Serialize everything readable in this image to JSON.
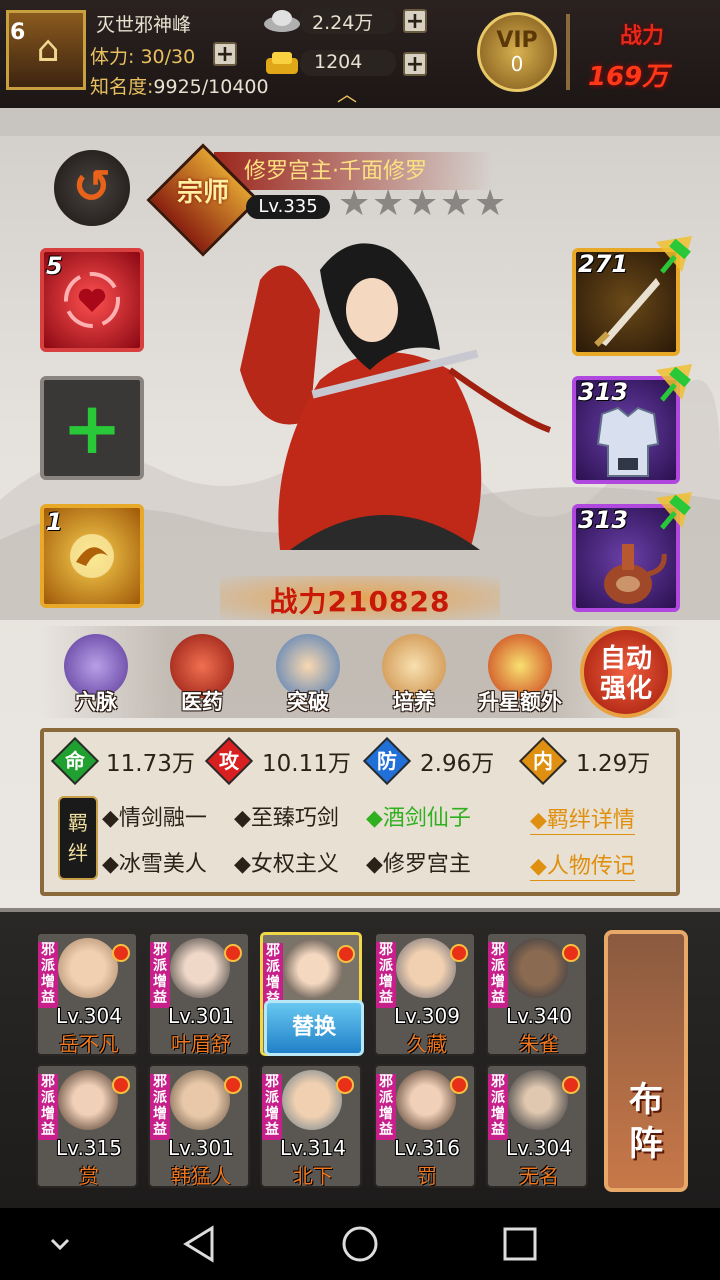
{
  "player": {
    "level": "6",
    "name": "灭世邪神峰",
    "stamina": "体力: 30/30",
    "fame_label": "知名度:",
    "fame_value": "9925/10400"
  },
  "currency": {
    "silver": "2.24万",
    "gold": "1204"
  },
  "vip": {
    "label": "VIP",
    "level": "0"
  },
  "top_power": {
    "label": "战力",
    "value": "169万"
  },
  "hero": {
    "rank_badge": "宗师",
    "name": "修罗宫主·千面修罗",
    "level": "Lv.335",
    "stars": 5,
    "power": "战力210828"
  },
  "skills": [
    {
      "count": "5",
      "icon": "heart-swirl-icon"
    },
    {
      "count": "",
      "icon": "add-icon"
    },
    {
      "count": "1",
      "icon": "golden-burst-icon"
    }
  ],
  "equipment": [
    {
      "level": "271",
      "icon": "sword-icon"
    },
    {
      "level": "313",
      "icon": "armor-icon"
    },
    {
      "level": "313",
      "icon": "vase-icon"
    }
  ],
  "menu": [
    {
      "label": "穴脉",
      "icon": "meridian-icon"
    },
    {
      "label": "医药",
      "icon": "medicine-icon"
    },
    {
      "label": "突破",
      "icon": "breakthrough-icon"
    },
    {
      "label": "培养",
      "icon": "cultivate-icon"
    },
    {
      "label": "升星额外",
      "icon": "star-up-icon"
    }
  ],
  "auto_button": {
    "line1": "自动",
    "line2": "强化"
  },
  "stats": [
    {
      "badge": "命",
      "value": "11.73万",
      "color": "#20a030"
    },
    {
      "badge": "攻",
      "value": "10.11万",
      "color": "#d82020"
    },
    {
      "badge": "防",
      "value": "2.96万",
      "color": "#2070d8"
    },
    {
      "badge": "内",
      "value": "1.29万",
      "color": "#e09010"
    }
  ],
  "bonds": {
    "tag": "羁绊",
    "row1": [
      "◆情剑融一",
      "◆至臻巧剑",
      "◆酒剑仙子"
    ],
    "row2": [
      "◆冰雪美人",
      "◆女权主义",
      "◆修罗宫主"
    ],
    "link1": "◆羁绊详情",
    "link2": "◆人物传记"
  },
  "lineup": {
    "tag": "邪派增益",
    "replace_label": "替换",
    "formation_label": "布阵",
    "row1": [
      {
        "lv": "Lv.304",
        "name": "岳不凡"
      },
      {
        "lv": "Lv.301",
        "name": "叶眉舒"
      },
      {
        "lv": "",
        "name": ""
      },
      {
        "lv": "Lv.309",
        "name": "久藏"
      },
      {
        "lv": "Lv.340",
        "name": "朱雀"
      }
    ],
    "row2": [
      {
        "lv": "Lv.315",
        "name": "赏"
      },
      {
        "lv": "Lv.301",
        "name": "韩猛人"
      },
      {
        "lv": "Lv.314",
        "name": "北下"
      },
      {
        "lv": "Lv.316",
        "name": "罚"
      },
      {
        "lv": "Lv.304",
        "name": "无名"
      }
    ]
  },
  "colors": {
    "accent_red": "#c81808",
    "gold": "#e8a828",
    "purple_rarity": "#b048e0"
  }
}
